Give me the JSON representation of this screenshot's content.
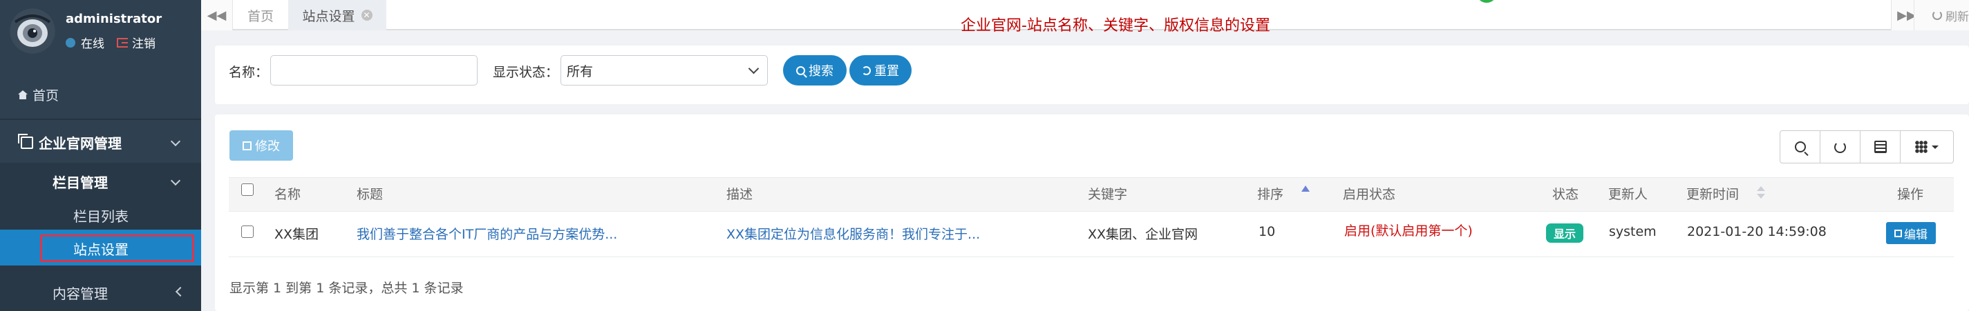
{
  "user": {
    "name": "administrator",
    "status": "在线",
    "logout": "注销"
  },
  "nav": {
    "home": "首页",
    "group": "企业官网管理",
    "sub_group": "栏目管理",
    "items": [
      "栏目列表",
      "站点设置"
    ],
    "more": "内容管理"
  },
  "tabs": {
    "home": "首页",
    "active": "站点设置",
    "refresh": "刷新"
  },
  "annotation": "企业官网-站点名称、关键字、版权信息的设置",
  "search_form": {
    "name_label": "名称：",
    "name_value": "",
    "status_label": "显示状态：",
    "status_value": "所有",
    "search_btn": "搜索",
    "reset_btn": "重置"
  },
  "toolbar": {
    "edit_btn": "修改"
  },
  "table": {
    "columns": [
      "名称",
      "标题",
      "描述",
      "关键字",
      "排序",
      "启用状态",
      "状态",
      "更新人",
      "更新时间",
      "操作"
    ],
    "rows": [
      {
        "name": "XX集团",
        "title": "我们善于整合各个IT厂商的产品与方案优势...",
        "desc": "XX集团定位为信息化服务商！我们专注于...",
        "keywords": "XX集团、企业官网",
        "order": "10",
        "enable": "启用(默认启用第一个)",
        "status": "显示",
        "updater": "system",
        "updated": "2021-01-20 14:59:08",
        "action": "编辑"
      }
    ],
    "footer": "显示第 1 到第 1 条记录，总共 1 条记录"
  },
  "colors": {
    "sidebar": "#2f4050",
    "primary": "#1c84c6",
    "success": "#1ab394",
    "danger": "#c00000"
  }
}
